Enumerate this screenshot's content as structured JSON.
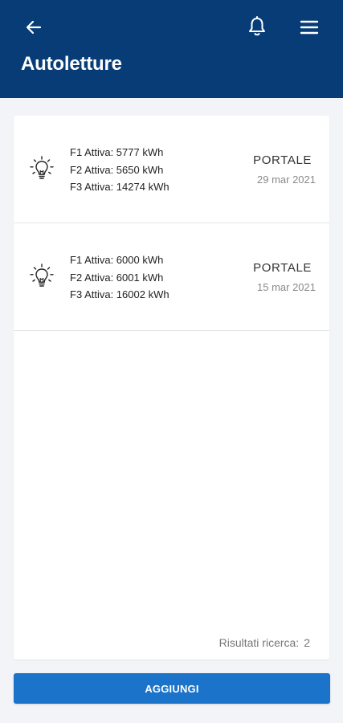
{
  "header": {
    "title": "Autoletture",
    "back_icon": "arrow-left-icon",
    "notifications_icon": "bell-icon",
    "menu_icon": "hamburger-menu-icon",
    "background_color": "#073c77"
  },
  "readings": [
    {
      "icon": "lightbulb-icon",
      "lines": [
        "F1 Attiva: 5777 kWh",
        "F2 Attiva: 5650 kWh",
        "F3 Attiva: 14274 kWh"
      ],
      "source": "PORTALE",
      "date": "29 mar 2021"
    },
    {
      "icon": "lightbulb-icon",
      "lines": [
        "F1 Attiva: 6000 kWh",
        "F2 Attiva: 6001 kWh",
        "F3 Attiva: 16002 kWh"
      ],
      "source": "PORTALE",
      "date": "15 mar 2021"
    }
  ],
  "results": {
    "label": "Risultati ricerca:",
    "count": "2"
  },
  "actions": {
    "add_label": "AGGIUNGI",
    "button_color": "#1b74c9"
  }
}
